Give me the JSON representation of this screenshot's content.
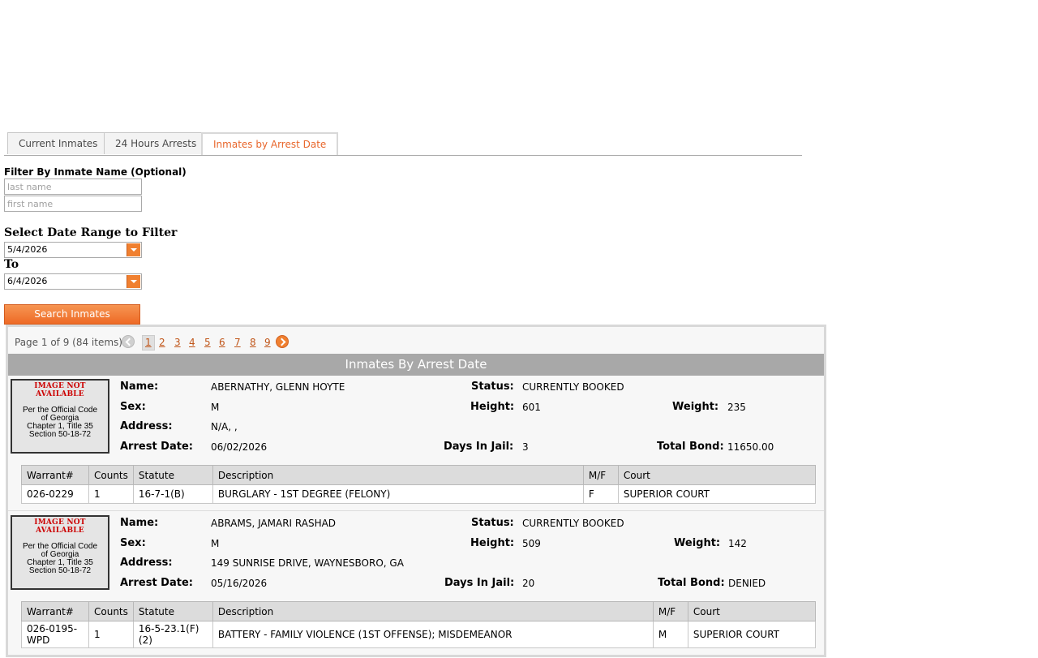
{
  "tabs": [
    {
      "label": "Current Inmates",
      "active": false
    },
    {
      "label": "24 Hours Arrests",
      "active": false
    },
    {
      "label": "Inmates by Arrest Date",
      "active": true
    }
  ],
  "filter": {
    "name_label": "Filter By Inmate Name (Optional)",
    "last_placeholder": "last name",
    "first_placeholder": "first name",
    "date_label": "Select Date Range to Filter",
    "from_date": "5/4/2026",
    "to_label": "To",
    "to_date": "6/4/2026",
    "search_label": "Search Inmates"
  },
  "pager": {
    "info": "Page 1 of 9 (84 items)",
    "pages": [
      "1",
      "2",
      "3",
      "4",
      "5",
      "6",
      "7",
      "8",
      "9"
    ],
    "current": "1"
  },
  "grid_title": "Inmates By Arrest Date",
  "photo": {
    "not_available": "IMAGE NOT AVAILABLE",
    "code_lines": [
      "Per the Official Code",
      "of Georgia",
      "Chapter 1, Title 35",
      "Section 50-18-72"
    ]
  },
  "labels": {
    "name": "Name:",
    "status": "Status:",
    "sex": "Sex:",
    "height": "Height:",
    "weight": "Weight:",
    "address": "Address:",
    "arrest_date": "Arrest Date:",
    "days_in_jail": "Days In Jail:",
    "total_bond": "Total Bond:"
  },
  "warrant_headers": [
    "Warrant#",
    "Counts",
    "Statute",
    "Description",
    "M/F",
    "Court"
  ],
  "records": [
    {
      "name": "ABERNATHY, GLENN HOYTE",
      "status": "CURRENTLY BOOKED",
      "sex": "M",
      "height": "601",
      "weight": "235",
      "address": "N/A, ,",
      "arrest_date": "06/02/2026",
      "days_in_jail": "3",
      "total_bond": "11650.00",
      "warrants": [
        {
          "warrant": "026-0229",
          "counts": "1",
          "statute": "16-7-1(B)",
          "description": "BURGLARY - 1ST DEGREE (FELONY)",
          "mf": "F",
          "court": "SUPERIOR COURT"
        }
      ]
    },
    {
      "name": "ABRAMS, JAMARI RASHAD",
      "status": "CURRENTLY BOOKED",
      "sex": "M",
      "height": "509",
      "weight": "142",
      "address": "149 SUNRISE DRIVE, WAYNESBORO, GA",
      "arrest_date": "05/16/2026",
      "days_in_jail": "20",
      "total_bond": "DENIED",
      "warrants": [
        {
          "warrant": "026-0195-WPD",
          "counts": "1",
          "statute": "16-5-23.1(F)(2)",
          "description": "BATTERY - FAMILY VIOLENCE (1ST OFFENSE); MISDEMEANOR",
          "mf": "M",
          "court": "SUPERIOR COURT"
        }
      ]
    }
  ]
}
